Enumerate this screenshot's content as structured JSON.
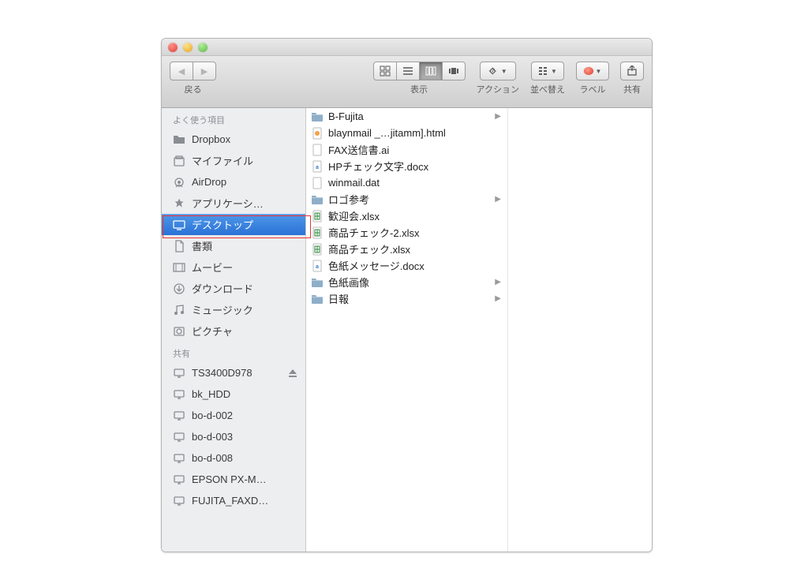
{
  "toolbar": {
    "back_label": "戻る",
    "view_label": "表示",
    "action_label": "アクション",
    "arrange_label": "並べ替え",
    "label_label": "ラベル",
    "share_label": "共有"
  },
  "sidebar": {
    "section_favorites": "よく使う項目",
    "favorites": [
      {
        "label": "Dropbox",
        "icon": "folder"
      },
      {
        "label": "マイファイル",
        "icon": "allmyfiles"
      },
      {
        "label": "AirDrop",
        "icon": "airdrop"
      },
      {
        "label": "アプリケーシ…",
        "icon": "apps"
      },
      {
        "label": "デスクトップ",
        "icon": "desktop",
        "selected": true
      },
      {
        "label": "書類",
        "icon": "docs"
      },
      {
        "label": "ムービー",
        "icon": "movies"
      },
      {
        "label": "ダウンロード",
        "icon": "downloads"
      },
      {
        "label": "ミュージック",
        "icon": "music"
      },
      {
        "label": "ピクチャ",
        "icon": "pictures"
      }
    ],
    "section_shared": "共有",
    "shared": [
      {
        "label": "TS3400D978",
        "icon": "monitor",
        "eject": true
      },
      {
        "label": "bk_HDD",
        "icon": "monitor"
      },
      {
        "label": "bo-d-002",
        "icon": "monitor"
      },
      {
        "label": "bo-d-003",
        "icon": "monitor"
      },
      {
        "label": "bo-d-008",
        "icon": "monitor"
      },
      {
        "label": "EPSON PX-M…",
        "icon": "monitor"
      },
      {
        "label": "FUJITA_FAXD…",
        "icon": "monitor"
      }
    ]
  },
  "files": [
    {
      "label": "B-Fujita",
      "type": "folder",
      "arrow": true
    },
    {
      "label": "blaynmail _…jitamm].html",
      "type": "html"
    },
    {
      "label": "FAX送信書.ai",
      "type": "file"
    },
    {
      "label": "HPチェック文字.docx",
      "type": "docx"
    },
    {
      "label": "winmail.dat",
      "type": "file"
    },
    {
      "label": "ロゴ参考",
      "type": "folder",
      "arrow": true
    },
    {
      "label": "歓迎会.xlsx",
      "type": "xlsx"
    },
    {
      "label": "商品チェック-2.xlsx",
      "type": "xlsx"
    },
    {
      "label": "商品チェック.xlsx",
      "type": "xlsx"
    },
    {
      "label": "色紙メッセージ.docx",
      "type": "docx"
    },
    {
      "label": "色紙画像",
      "type": "folder",
      "arrow": true
    },
    {
      "label": "日報",
      "type": "folder",
      "arrow": true
    }
  ]
}
